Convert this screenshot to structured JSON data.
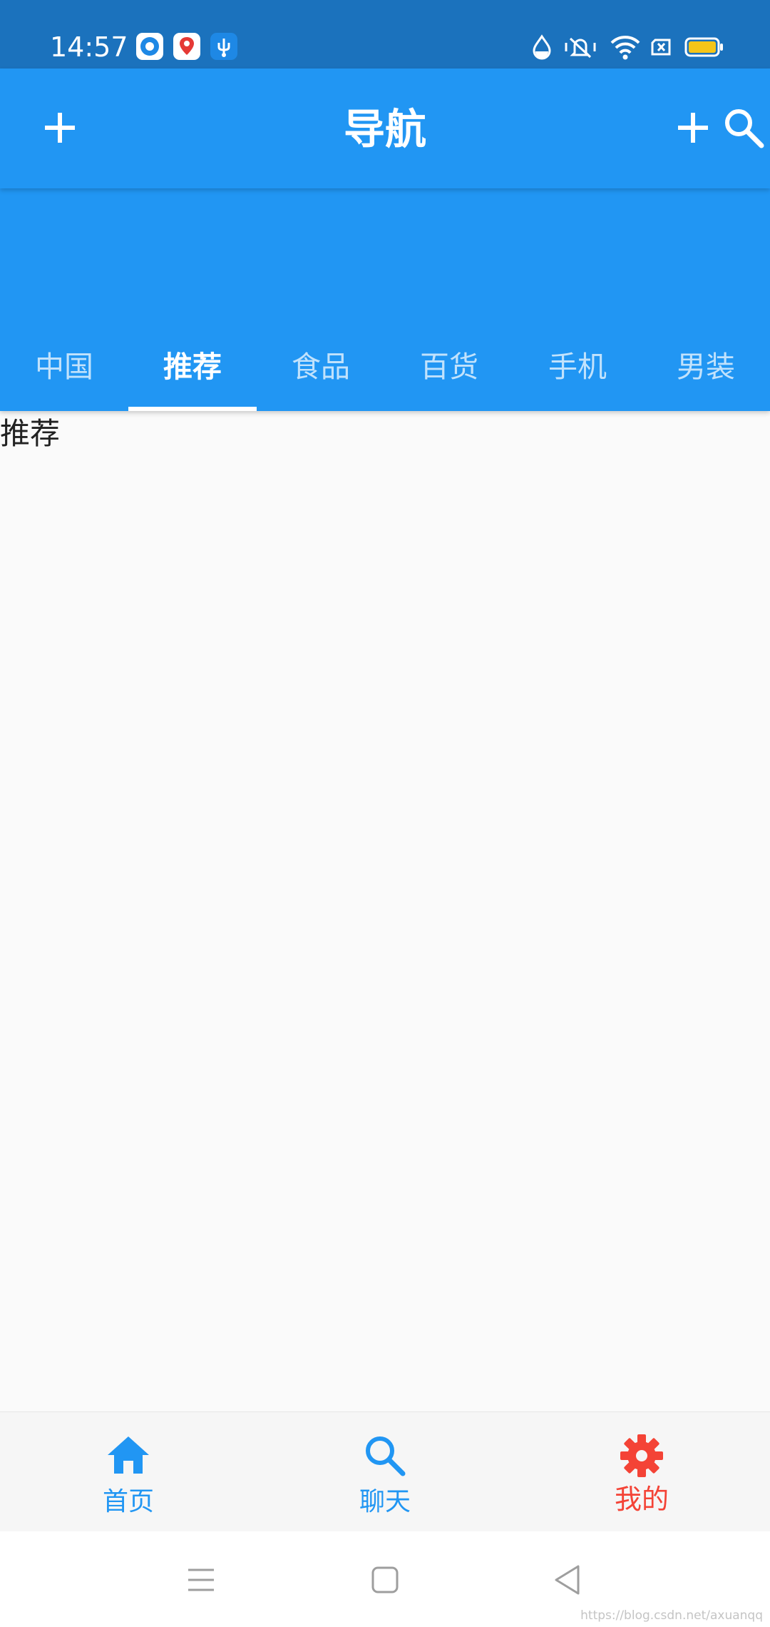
{
  "status_bar": {
    "time": "14:57",
    "notification_icons": [
      "app-circle-icon",
      "map-pin-icon",
      "usb-icon"
    ],
    "system_icons": [
      "water-drop-icon",
      "vibrate-mute-icon",
      "wifi-icon",
      "no-sim-icon",
      "battery-icon"
    ],
    "battery_color": "#f5c518"
  },
  "app_bar": {
    "title": "导航",
    "left_icon": "add-icon",
    "right_icons": [
      "add-icon",
      "search-icon"
    ]
  },
  "tabs": [
    {
      "label": "中国",
      "active": false
    },
    {
      "label": "推荐",
      "active": true
    },
    {
      "label": "食品",
      "active": false
    },
    {
      "label": "百货",
      "active": false
    },
    {
      "label": "手机",
      "active": false
    },
    {
      "label": "男装",
      "active": false
    }
  ],
  "content": {
    "text": "推荐"
  },
  "bottom_nav": {
    "items": [
      {
        "label": "首页",
        "icon": "home-icon",
        "color": "#2196f3"
      },
      {
        "label": "聊天",
        "icon": "search-icon",
        "color": "#2196f3"
      },
      {
        "label": "我的",
        "icon": "settings-icon",
        "color": "#f44336"
      }
    ]
  },
  "system_nav": {
    "buttons": [
      "menu-icon",
      "home-square-icon",
      "back-triangle-icon"
    ]
  },
  "watermark": "https://blog.csdn.net/axuanqq",
  "colors": {
    "primary": "#2196f3",
    "status_bar": "#1b72bd",
    "accent_red": "#f44336",
    "background": "#fafafa"
  }
}
